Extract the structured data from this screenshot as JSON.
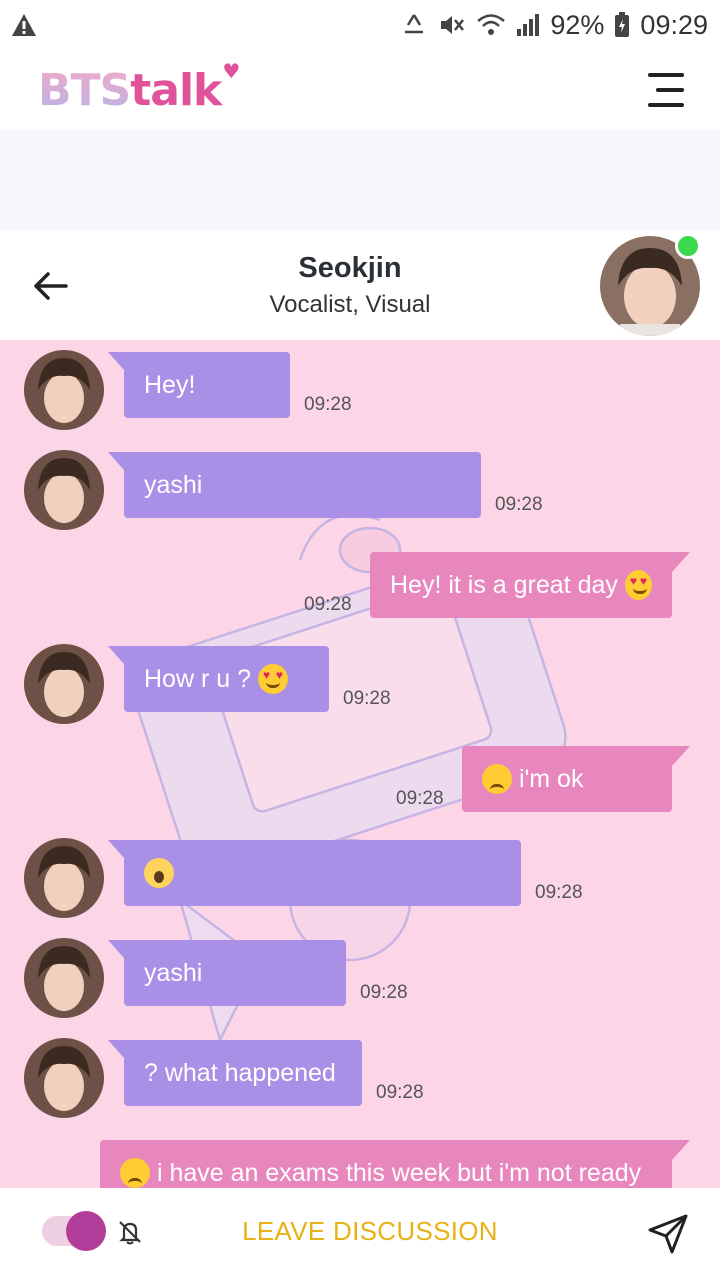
{
  "status_bar": {
    "alert_icon": "warning-icon",
    "battery": "92%",
    "time": "09:29"
  },
  "app": {
    "logo_bts": "BTS",
    "logo_talk": "talk",
    "menu_icon": "hamburger-icon"
  },
  "chat_header": {
    "name": "Seokjin",
    "role": "Vocalist, Visual",
    "online": true
  },
  "colors": {
    "incoming_bubble": "#a98fe6",
    "outgoing_bubble": "#e887bd",
    "chat_background": "#fcd6e7",
    "leave_text": "#e7b214",
    "online": "#3ad94b"
  },
  "messages": [
    {
      "dir": "in",
      "text": "Hey!",
      "time": "09:28"
    },
    {
      "dir": "in",
      "text": "yashi",
      "time": "09:28"
    },
    {
      "dir": "out",
      "text": "Hey! it is a great day",
      "emoji": "heart-eyes",
      "time": "09:28"
    },
    {
      "dir": "in",
      "text": "How r u ?",
      "emoji": "heart-eyes",
      "time": "09:28"
    },
    {
      "dir": "out",
      "text": "i'm ok",
      "emoji_before": "sweat",
      "time": "09:28"
    },
    {
      "dir": "in",
      "text": "",
      "emoji_before": "scream",
      "time": "09:28"
    },
    {
      "dir": "in",
      "text": "yashi",
      "time": "09:28"
    },
    {
      "dir": "in",
      "text": "? what happened",
      "time": "09:28"
    },
    {
      "dir": "out",
      "text": "i have an exams this week but i'm not ready",
      "emoji_before": "tired",
      "time": ""
    }
  ],
  "bottom_bar": {
    "leave_label": "LEAVE DISCUSSION",
    "toggle_on": true
  }
}
